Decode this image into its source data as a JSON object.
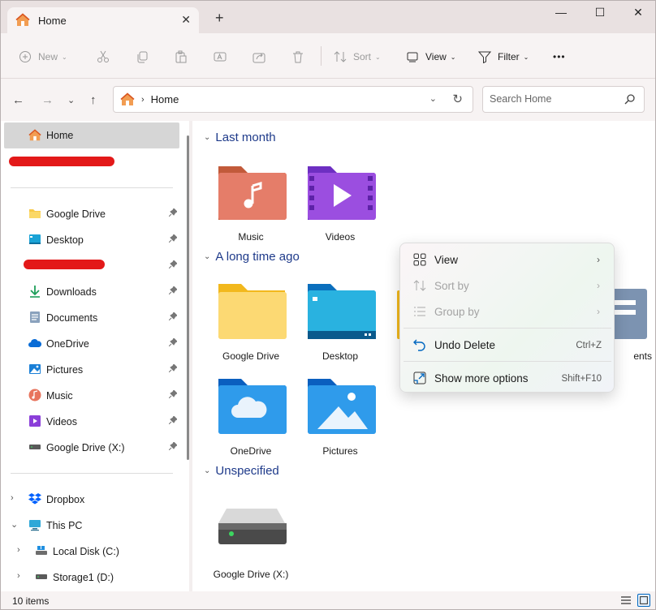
{
  "window": {
    "tab_title": "Home",
    "controls": {
      "minimize": "—",
      "maximize": "☐",
      "close": "✕"
    }
  },
  "toolbar": {
    "new_label": "New",
    "sort_label": "Sort",
    "view_label": "View",
    "filter_label": "Filter",
    "more_label": "•••"
  },
  "address": {
    "crumb": "Home",
    "search_placeholder": "Search Home"
  },
  "sidebar": {
    "home": "Home",
    "pinned": [
      {
        "label": "Google Drive",
        "icon": "folder-icon"
      },
      {
        "label": "Desktop",
        "icon": "desktop-icon"
      },
      {
        "label": "",
        "icon": "redacted"
      },
      {
        "label": "Downloads",
        "icon": "download-icon"
      },
      {
        "label": "Documents",
        "icon": "documents-icon"
      },
      {
        "label": "OneDrive",
        "icon": "onedrive-icon"
      },
      {
        "label": "Pictures",
        "icon": "pictures-icon"
      },
      {
        "label": "Music",
        "icon": "music-icon"
      },
      {
        "label": "Videos",
        "icon": "videos-icon"
      },
      {
        "label": "Google Drive (X:)",
        "icon": "drive-icon"
      }
    ],
    "tree": [
      {
        "label": "Dropbox",
        "icon": "dropbox-icon"
      },
      {
        "label": "This PC",
        "icon": "pc-icon"
      },
      {
        "label": "Local Disk (C:)",
        "icon": "local-disk-icon"
      },
      {
        "label": "Storage1 (D:)",
        "icon": "drive-icon"
      }
    ]
  },
  "main": {
    "groups": [
      {
        "title": "Last month",
        "items": [
          "Music",
          "Videos"
        ]
      },
      {
        "title": "A long time ago",
        "items": [
          "Google Drive",
          "Desktop",
          "ents",
          "OneDrive",
          "Pictures"
        ]
      },
      {
        "title": "Unspecified",
        "items": [
          "Google Drive (X:)"
        ]
      }
    ]
  },
  "context_menu": {
    "items": [
      {
        "label": "View",
        "enabled": true,
        "icon": "grid-icon"
      },
      {
        "label": "Sort by",
        "enabled": false,
        "icon": "sort-icon"
      },
      {
        "label": "Group by",
        "enabled": false,
        "icon": "group-icon"
      },
      {
        "label": "Undo Delete",
        "enabled": true,
        "icon": "undo-icon",
        "shortcut": "Ctrl+Z"
      },
      {
        "label": "Show more options",
        "enabled": true,
        "icon": "more-options-icon",
        "shortcut": "Shift+F10"
      }
    ]
  },
  "status": {
    "item_count": "10 items"
  },
  "colors": {
    "accent": "#0067c0",
    "group_header": "#1e3a8a",
    "redaction": "#e31919"
  }
}
